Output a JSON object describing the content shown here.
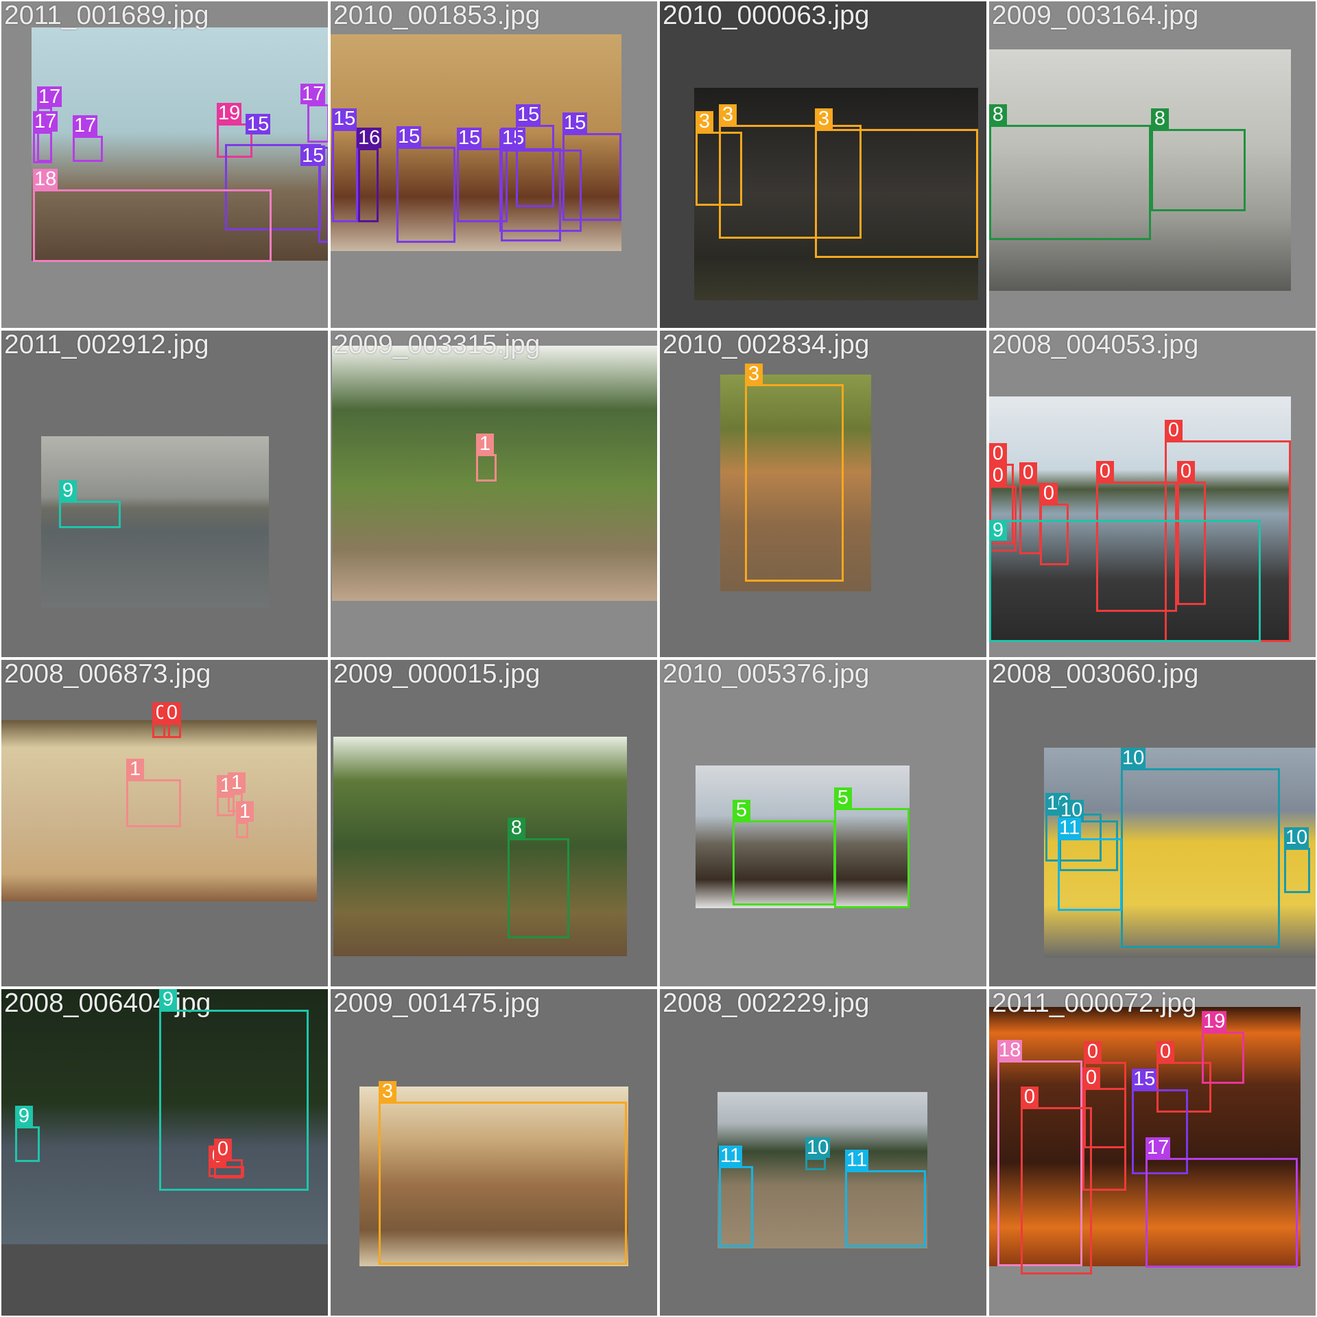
{
  "class_colors": {
    "0": "#ee3b3b",
    "1": "#f28b8b",
    "3": "#f8a81e",
    "5": "#44e01a",
    "8": "#1f9140",
    "9": "#1ec5aa",
    "10": "#1b9aaa",
    "11": "#12b5e8",
    "15": "#7a3ae8",
    "16": "#55129a",
    "17": "#b53de8",
    "18": "#f07fc0",
    "19": "#e8369b"
  },
  "tiles": [
    {
      "filename": "2011_001689.jpg",
      "bg": "#8a8a8a",
      "photo": {
        "gradient": "linear-gradient(180deg,#bcd6dc 0%,#a9c7cc 45%,#7d6b55 70%,#5b4636 100%)"
      },
      "boxes": [
        {
          "cls": "17",
          "label": "17"
        },
        {
          "cls": "17",
          "label": "17"
        },
        {
          "cls": "17",
          "label": "17"
        },
        {
          "cls": "17",
          "label": "17"
        },
        {
          "cls": "19",
          "label": "19"
        },
        {
          "cls": "15",
          "label": "15"
        },
        {
          "cls": "15",
          "label": "15"
        },
        {
          "cls": "18",
          "label": "18"
        }
      ]
    },
    {
      "filename": "2010_001853.jpg",
      "bg": "#8a8a8a",
      "photo": {
        "gradient": "linear-gradient(180deg,#caa66a 0%,#b98d52 45%,#6a3b22 75%,#c9b8a4 100%)"
      },
      "boxes": [
        {
          "cls": "15",
          "label": "15"
        },
        {
          "cls": "16",
          "label": "16"
        },
        {
          "cls": "15",
          "label": "15"
        },
        {
          "cls": "15",
          "label": "15"
        },
        {
          "cls": "15",
          "label": "15"
        },
        {
          "cls": "15",
          "label": "15"
        },
        {
          "cls": "15",
          "label": "15"
        },
        {
          "cls": "15",
          "label": "15"
        }
      ]
    },
    {
      "filename": "2010_000063.jpg",
      "bg": "#424242",
      "photo": {
        "gradient": "linear-gradient(180deg,#1e1e1c 0%,#3a3733 50%,#2a2a24 80%,#3b3a2c 100%)"
      },
      "boxes": [
        {
          "cls": "3",
          "label": "3"
        },
        {
          "cls": "3",
          "label": "3"
        },
        {
          "cls": "3",
          "label": "3"
        }
      ]
    },
    {
      "filename": "2009_003164.jpg",
      "bg": "#8a8a8a",
      "photo": {
        "gradient": "linear-gradient(180deg,#d4d4d0 0%,#bfbfb9 40%,#9b9b95 70%,#5b5b58 100%)"
      },
      "boxes": [
        {
          "cls": "8",
          "label": "8"
        },
        {
          "cls": "8",
          "label": "8"
        }
      ]
    },
    {
      "filename": "2011_002912.jpg",
      "bg": "#707070",
      "photo": {
        "gradient": "linear-gradient(180deg,#b4b4ae 0%,#8f918c 35%,#6c6d63 42%,#5d6466 55%,#717474 100%)"
      },
      "boxes": [
        {
          "cls": "9",
          "label": "9"
        }
      ]
    },
    {
      "filename": "2009_003315.jpg",
      "bg": "#8a8a8a",
      "photo": {
        "gradient": "linear-gradient(180deg,#eef0ea 0%,#4d6a3a 25%,#6b8a40 55%,#8a7a5c 80%,#bfa58c 100%)"
      },
      "boxes": [
        {
          "cls": "1",
          "label": "1"
        }
      ]
    },
    {
      "filename": "2010_002834.jpg",
      "bg": "#707070",
      "photo": {
        "gradient": "linear-gradient(180deg,#8a9a4a 0%,#6d7a36 25%,#b7824a 45%,#8c6a48 70%,#7a6248 100%)"
      },
      "boxes": [
        {
          "cls": "3",
          "label": "3"
        }
      ]
    },
    {
      "filename": "2008_004053.jpg",
      "bg": "#8a8a8a",
      "photo": {
        "gradient": "linear-gradient(180deg,#e4e8ec 0%,#c9d6de 30%,#4d5a3e 38%,#8fa3b0 48%,#3a3a3a 75%,#2a2a2a 100%)"
      },
      "boxes": [
        {
          "cls": "0",
          "label": "0"
        },
        {
          "cls": "0",
          "label": "0"
        },
        {
          "cls": "0",
          "label": "0"
        },
        {
          "cls": "0",
          "label": "0"
        },
        {
          "cls": "0",
          "label": "0"
        },
        {
          "cls": "0",
          "label": "0"
        },
        {
          "cls": "0",
          "label": "0"
        },
        {
          "cls": "9",
          "label": "9"
        }
      ]
    },
    {
      "filename": "2008_006873.jpg",
      "bg": "#707070",
      "photo": {
        "gradient": "linear-gradient(180deg,#6a5a3c 0%,#d9c9a0 15%,#cdb58f 55%,#c9a878 85%,#8a6040 100%)"
      },
      "boxes": [
        {
          "cls": "0",
          "label": "0"
        },
        {
          "cls": "0",
          "label": "0"
        },
        {
          "cls": "1",
          "label": "1"
        },
        {
          "cls": "1",
          "label": "1"
        },
        {
          "cls": "1",
          "label": "1"
        },
        {
          "cls": "1",
          "label": "1"
        }
      ]
    },
    {
      "filename": "2009_000015.jpg",
      "bg": "#707070",
      "photo": {
        "gradient": "linear-gradient(180deg,#e6ece0 0%,#5f7a3a 20%,#3e5a2e 50%,#7a6a3c 80%,#6a5238 100%)"
      },
      "boxes": [
        {
          "cls": "8",
          "label": "8"
        }
      ]
    },
    {
      "filename": "2010_005376.jpg",
      "bg": "#8a8a8a",
      "photo": {
        "gradient": "linear-gradient(180deg,#d5d8dc 0%,#b5bfc8 35%,#6a6458 55%,#3a2e24 80%,#e2e2e2 100%)"
      },
      "boxes": [
        {
          "cls": "5",
          "label": "5"
        },
        {
          "cls": "5",
          "label": "5"
        }
      ]
    },
    {
      "filename": "2008_003060.jpg",
      "bg": "#707070",
      "photo": {
        "gradient": "linear-gradient(180deg,#9aa6b2 0%,#7f8a96 30%,#e5c23a 45%,#e8c94a 75%,#6a6a6a 100%)"
      },
      "boxes": [
        {
          "cls": "10",
          "label": "10"
        },
        {
          "cls": "10",
          "label": "10"
        },
        {
          "cls": "10",
          "label": "10"
        },
        {
          "cls": "11",
          "label": "11"
        },
        {
          "cls": "10",
          "label": "10"
        }
      ]
    },
    {
      "filename": "2008_006404.jpg",
      "bg": "#4f4f4f",
      "photo": {
        "gradient": "linear-gradient(180deg,#1c2a1a 0%,#25361f 45%,#4a5560 62%,#5a6670 100%)"
      },
      "boxes": [
        {
          "cls": "9",
          "label": "9"
        },
        {
          "cls": "9",
          "label": "9"
        },
        {
          "cls": "0",
          "label": "0"
        },
        {
          "cls": "0",
          "label": "0"
        }
      ]
    },
    {
      "filename": "2009_001475.jpg",
      "bg": "#707070",
      "photo": {
        "gradient": "linear-gradient(180deg,#e8dcc0 0%,#c9a878 30%,#9a7048 55%,#7a5a3a 80%,#d8c8a8 100%)"
      },
      "boxes": [
        {
          "cls": "3",
          "label": "3"
        }
      ]
    },
    {
      "filename": "2008_002229.jpg",
      "bg": "#707070",
      "photo": {
        "gradient": "linear-gradient(180deg,#c9ced2 0%,#aeb6bc 20%,#3a4a32 38%,#8a7a62 60%,#9c8a70 100%)"
      },
      "boxes": [
        {
          "cls": "11",
          "label": "11"
        },
        {
          "cls": "10",
          "label": "10"
        },
        {
          "cls": "11",
          "label": "11"
        }
      ]
    },
    {
      "filename": "2011_000072.jpg",
      "bg": "#8a8a8a",
      "photo": {
        "gradient": "linear-gradient(180deg,#3a1a0a 0%,#e06a1a 10%,#5a2a14 30%,#3a1c10 60%,#e0701c 85%,#8a3a12 100%)"
      },
      "boxes": [
        {
          "cls": "18",
          "label": "18"
        },
        {
          "cls": "0",
          "label": "0"
        },
        {
          "cls": "0",
          "label": "0"
        },
        {
          "cls": "0",
          "label": "0"
        },
        {
          "cls": "0",
          "label": "0"
        },
        {
          "cls": "19",
          "label": "19"
        },
        {
          "cls": "15",
          "label": "15"
        },
        {
          "cls": "17",
          "label": "17"
        }
      ]
    }
  ]
}
